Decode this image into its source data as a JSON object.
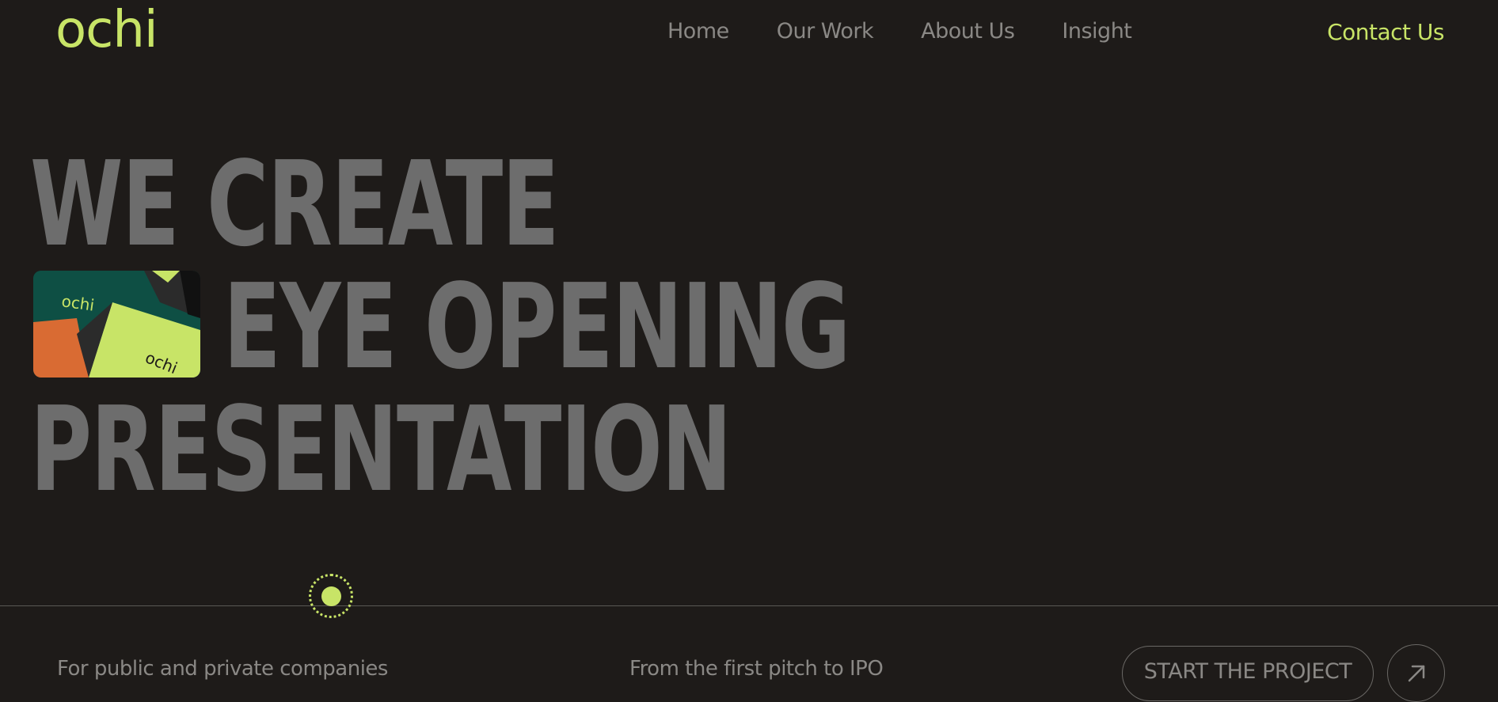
{
  "brand": {
    "logo_text": "ochi"
  },
  "nav": {
    "items": [
      {
        "label": "Home"
      },
      {
        "label": "Our Work"
      },
      {
        "label": "About Us"
      },
      {
        "label": "Insight"
      }
    ],
    "contact_label": "Contact Us"
  },
  "hero": {
    "line1": "WE CREATE",
    "line2": "EYE OPENING",
    "line3": "PRESENTATION",
    "thumbnail_labels": [
      "ochi",
      "ochi"
    ]
  },
  "footer": {
    "left_text": "For public and private companies",
    "middle_text": "From the first pitch to IPO",
    "cta_label": "START THE PROJECT",
    "cta_icon": "arrow-up-right-icon"
  },
  "colors": {
    "background": "#1e1b19",
    "accent": "#c8e467",
    "muted_text": "#8a8885",
    "hero_text": "#6d6d6d"
  }
}
